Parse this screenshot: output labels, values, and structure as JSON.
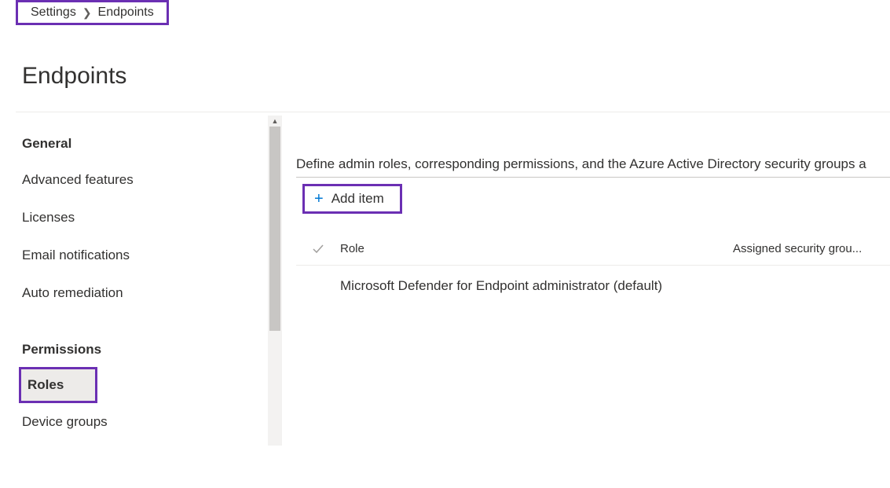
{
  "breadcrumb": {
    "parent": "Settings",
    "current": "Endpoints"
  },
  "page": {
    "title": "Endpoints"
  },
  "sidebar": {
    "section_general": "General",
    "items_general": [
      "Advanced features",
      "Licenses",
      "Email notifications",
      "Auto remediation"
    ],
    "section_permissions": "Permissions",
    "items_permissions": [
      "Roles",
      "Device groups"
    ],
    "active_item": "Roles"
  },
  "main": {
    "description": "Define admin roles, corresponding permissions, and the Azure Active Directory security groups a",
    "add_button": "Add item",
    "table": {
      "columns": {
        "role": "Role",
        "groups": "Assigned security grou..."
      },
      "rows": [
        {
          "role": "Microsoft Defender for Endpoint administrator (default)",
          "groups": ""
        }
      ]
    }
  }
}
